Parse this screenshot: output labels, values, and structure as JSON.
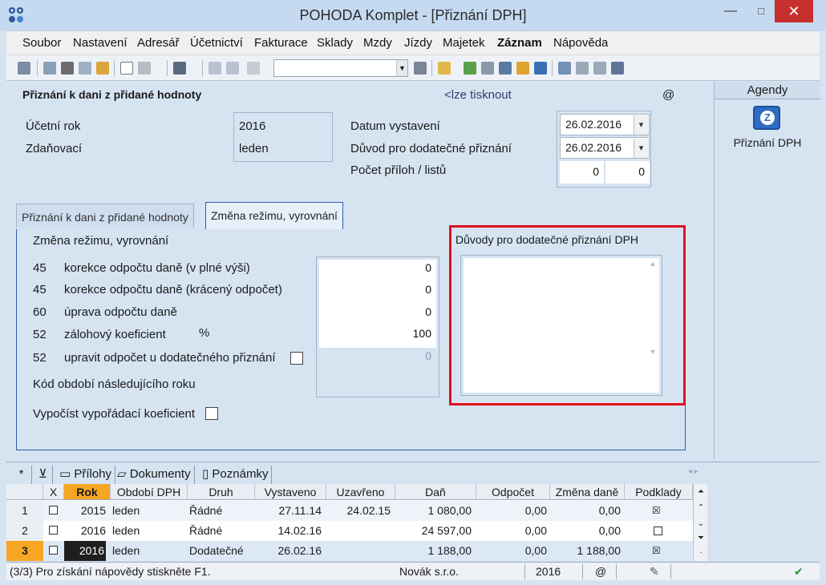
{
  "window": {
    "title": "POHODA Komplet - [Přiznání DPH]",
    "minimize": "—",
    "maximize": "□",
    "close": "✕"
  },
  "menu": [
    {
      "label": "Soubor"
    },
    {
      "label": "Nastavení"
    },
    {
      "label": "Adresář"
    },
    {
      "label": "Účetnictví"
    },
    {
      "label": "Fakturace"
    },
    {
      "label": "Sklady"
    },
    {
      "label": "Mzdy"
    },
    {
      "label": "Jízdy"
    },
    {
      "label": "Majetek"
    },
    {
      "label": "Záznam"
    },
    {
      "label": "Nápověda"
    }
  ],
  "toolbar": {
    "combo_value": ""
  },
  "form": {
    "title": "Přiznání k dani z přidané hodnoty",
    "print_hint": "<lze tisknout",
    "at_sign": "@",
    "ucetni_rok_label": "Účetní rok",
    "ucetni_rok_value": "2016",
    "zdanovaci_label": "Zdaňovací",
    "zdanovaci_value": "leden",
    "datum_vystaveni_label": "Datum vystavení",
    "datum_vystaveni_value": "26.02.2016",
    "duvod_label": "Důvod pro dodatečné přiznání",
    "duvod_value": "26.02.2016",
    "pocet_priloh_label": "Počet příloh / listů",
    "pocet_priloh_value": "0",
    "pocet_listu_value": "0"
  },
  "tabs": {
    "tab1": "Přiznání k dani z přidané hodnoty",
    "tab2": "Změna režimu, vyrovnání"
  },
  "panel": {
    "heading": "Změna režimu, vyrovnání",
    "rows": [
      {
        "code": "45",
        "label": "korekce odpočtu daně (v plné výši)",
        "value": "0"
      },
      {
        "code": "45",
        "label": "korekce odpočtu daně (krácený odpočet)",
        "value": "0"
      },
      {
        "code": "60",
        "label": "úprava odpočtu daně",
        "value": "0"
      },
      {
        "code": "52",
        "label": "zálohový koeficient",
        "unit": "%",
        "value": "100"
      },
      {
        "code": "52",
        "label": "upravit odpočet u dodatečného přiznání",
        "value": "0"
      }
    ],
    "kod_obdobi_label": "Kód období následujícího roku",
    "vypocist_label": "Vypočíst vypořádací koeficient",
    "duvody_label": "Důvody pro dodatečné přiznání DPH"
  },
  "agendy": {
    "header": "Agendy",
    "item": "Přiznání DPH"
  },
  "bottom_tabs": {
    "star": "*",
    "prilohy": "Přílohy",
    "dokumenty": "Dokumenty",
    "poznamky": "Poznámky"
  },
  "table": {
    "headers": [
      "X",
      "Rok",
      "Období DPH",
      "Druh",
      "Vystaveno",
      "Uzavřeno",
      "Daň",
      "Odpočet",
      "Změna daně",
      "Podklady"
    ],
    "rows": [
      {
        "n": "1",
        "rok": "2015",
        "obdobi": "leden",
        "druh": "Řádné",
        "vystaveno": "27.11.14",
        "uzavreno": "24.02.15",
        "dan": "1 080,00",
        "odpocet": "0,00",
        "zmena": "0,00",
        "podklady": true
      },
      {
        "n": "2",
        "rok": "2016",
        "obdobi": "leden",
        "druh": "Řádné",
        "vystaveno": "14.02.16",
        "uzavreno": "",
        "dan": "24 597,00",
        "odpocet": "0,00",
        "zmena": "0,00",
        "podklady": false
      },
      {
        "n": "3",
        "rok": "2016",
        "obdobi": "leden",
        "druh": "Dodatečné",
        "vystaveno": "26.02.16",
        "uzavreno": "",
        "dan": "1 188,00",
        "odpocet": "0,00",
        "zmena": "1 188,00",
        "podklady": true
      }
    ]
  },
  "status": {
    "help": "(3/3) Pro získání nápovědy stiskněte F1.",
    "company": "Novák s.r.o.",
    "year": "2016",
    "at": "@"
  },
  "colors": {
    "highlight": "#e0121b",
    "accent": "#2a5fa8",
    "selected_row": "#f6a623"
  }
}
